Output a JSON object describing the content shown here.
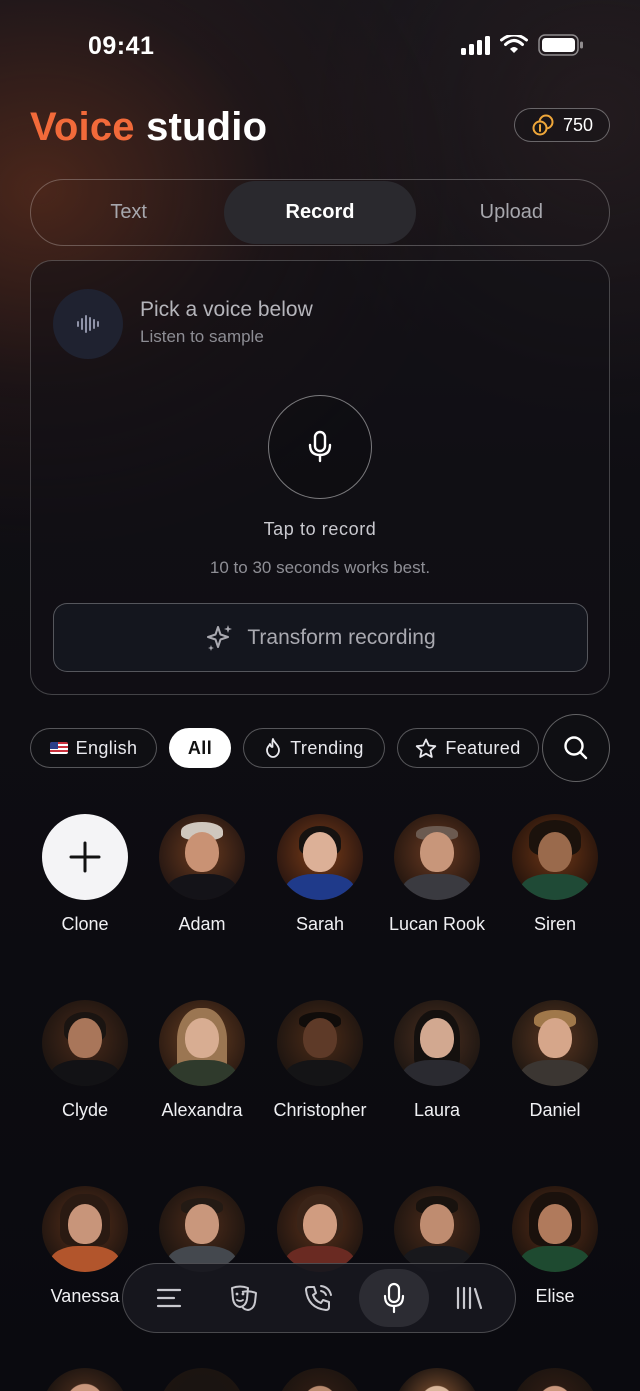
{
  "status_bar": {
    "time": "09:41"
  },
  "header": {
    "title_accent": "Voice",
    "title_rest": "studio",
    "credits": "750"
  },
  "tabs": [
    {
      "label": "Text",
      "active": false
    },
    {
      "label": "Record",
      "active": true
    },
    {
      "label": "Upload",
      "active": false
    }
  ],
  "recorder": {
    "title": "Pick a voice below",
    "subtitle": "Listen to sample",
    "tap_label": "Tap to record",
    "hint": "10 to 30 seconds works best.",
    "transform_label": "Transform recording"
  },
  "filters": {
    "language": "English",
    "all": "All",
    "trending": "Trending",
    "featured": "Featured"
  },
  "voices": [
    {
      "name": "Clone"
    },
    {
      "name": "Adam"
    },
    {
      "name": "Sarah"
    },
    {
      "name": "Lucan Rook"
    },
    {
      "name": "Siren"
    },
    {
      "name": "Clyde"
    },
    {
      "name": "Alexandra"
    },
    {
      "name": "Christopher"
    },
    {
      "name": "Laura"
    },
    {
      "name": "Daniel"
    },
    {
      "name": "Vanessa"
    },
    {
      "name": ""
    },
    {
      "name": ""
    },
    {
      "name": ""
    },
    {
      "name": "Elise"
    }
  ],
  "colors": {
    "accent": "#f26a3a",
    "background": "#0c0b10",
    "chip_active": "#ffffff"
  },
  "nav": [
    "menu-icon",
    "theater-masks-icon",
    "phone-call-icon",
    "microphone-icon",
    "library-icon"
  ]
}
